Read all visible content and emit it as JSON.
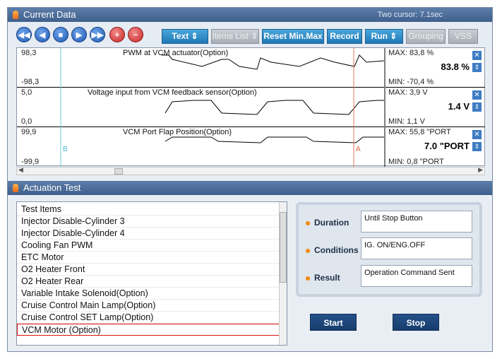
{
  "current_data": {
    "title": "Current Data",
    "cursor_info": "Two cursor: 7.1sec",
    "toolbar": {
      "text_label": "Text",
      "items_list_label": "Items List",
      "reset_label": "Reset Min.Max",
      "record_label": "Record",
      "run_label": "Run",
      "grouping_label": "Grouping",
      "vss_label": "VSS"
    },
    "plots": [
      {
        "title": "PWM at VCM actuator(Option)",
        "ymax": "98,3",
        "ymin": "-98,3",
        "max": "MAX:  83,8 %",
        "min": "MIN: -70,4 %",
        "value": "83.8 %"
      },
      {
        "title": "Voltage input from VCM feedback sensor(Option)",
        "ymax": "5,0",
        "ymin": "0,0",
        "max": "MAX:   3,9 V",
        "min": "MIN:   1,1 V",
        "value": "1.4 V"
      },
      {
        "title": "VCM Port Flap Position(Option)",
        "ymax": "99,9",
        "ymin": "-99,9",
        "max": "MAX:  55,8 \"PORT",
        "min": "MIN:   0,8 \"PORT",
        "value": "7.0 \"PORT"
      }
    ],
    "cursor_a": "A",
    "cursor_b": "B"
  },
  "actuation": {
    "title": "Actuation Test",
    "list_header": "Test Items",
    "items": [
      "Injector Disable-Cylinder 3",
      "Injector Disable-Cylinder 4",
      "Cooling Fan PWM",
      "ETC Motor",
      "O2 Heater Front",
      "O2 Heater Rear",
      "Variable Intake Solenoid(Option)",
      "Cruise Control Main Lamp(Option)",
      "Cruise Control SET Lamp(Option)",
      "VCM Motor (Option)"
    ],
    "selected_index": 9,
    "duration_label": "Duration",
    "duration_value": "Until Stop Button",
    "conditions_label": "Conditions",
    "conditions_value": "IG. ON/ENG.OFF",
    "result_label": "Result",
    "result_value": "Operation Command Sent",
    "start_label": "Start",
    "stop_label": "Stop"
  }
}
